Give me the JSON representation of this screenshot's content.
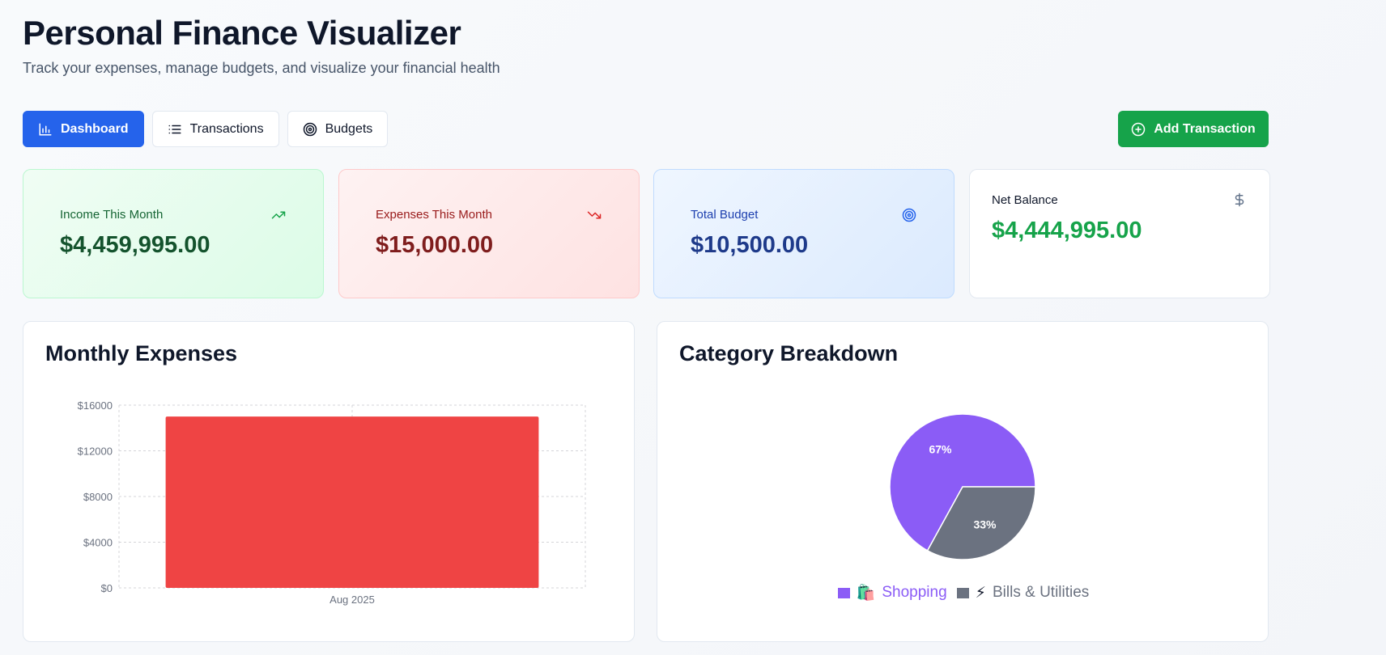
{
  "header": {
    "title": "Personal Finance Visualizer",
    "subtitle": "Track your expenses, manage budgets, and visualize your financial health"
  },
  "nav": {
    "tabs": [
      {
        "label": "Dashboard",
        "icon": "bar-chart-icon",
        "active": true
      },
      {
        "label": "Transactions",
        "icon": "list-icon",
        "active": false
      },
      {
        "label": "Budgets",
        "icon": "target-icon",
        "active": false
      }
    ],
    "add_button": {
      "label": "Add Transaction",
      "icon": "plus-circle-icon"
    }
  },
  "summary": {
    "income": {
      "label": "Income This Month",
      "value": "$4,459,995.00",
      "icon": "trending-up-icon",
      "color": "#16a34a"
    },
    "expenses": {
      "label": "Expenses This Month",
      "value": "$15,000.00",
      "icon": "trending-down-icon",
      "color": "#dc2626"
    },
    "budget": {
      "label": "Total Budget",
      "value": "$10,500.00",
      "icon": "target-icon",
      "color": "#2563eb"
    },
    "net": {
      "label": "Net Balance",
      "value": "$4,444,995.00",
      "icon": "dollar-icon",
      "color": "#16a34a"
    }
  },
  "monthly_panel": {
    "title": "Monthly Expenses"
  },
  "category_panel": {
    "title": "Category Breakdown",
    "legend": [
      {
        "emoji": "🛍️",
        "label": "Shopping",
        "color": "#8b5cf6"
      },
      {
        "emoji": "⚡",
        "label": "Bills & Utilities",
        "color": "#6b7280"
      }
    ]
  },
  "chart_data": [
    {
      "type": "bar",
      "categories": [
        "Aug 2025"
      ],
      "values": [
        15000
      ],
      "ylim": [
        0,
        16000
      ],
      "yticks": [
        0,
        4000,
        8000,
        12000,
        16000
      ],
      "ytick_labels": [
        "$0",
        "$4000",
        "$8000",
        "$12000",
        "$16000"
      ],
      "color": "#ef4444",
      "grid": true
    },
    {
      "type": "pie",
      "labels": [
        "Shopping",
        "Bills & Utilities"
      ],
      "values": [
        67,
        33
      ],
      "value_labels": [
        "67%",
        "33%"
      ],
      "colors": [
        "#8b5cf6",
        "#6b7280"
      ]
    }
  ]
}
